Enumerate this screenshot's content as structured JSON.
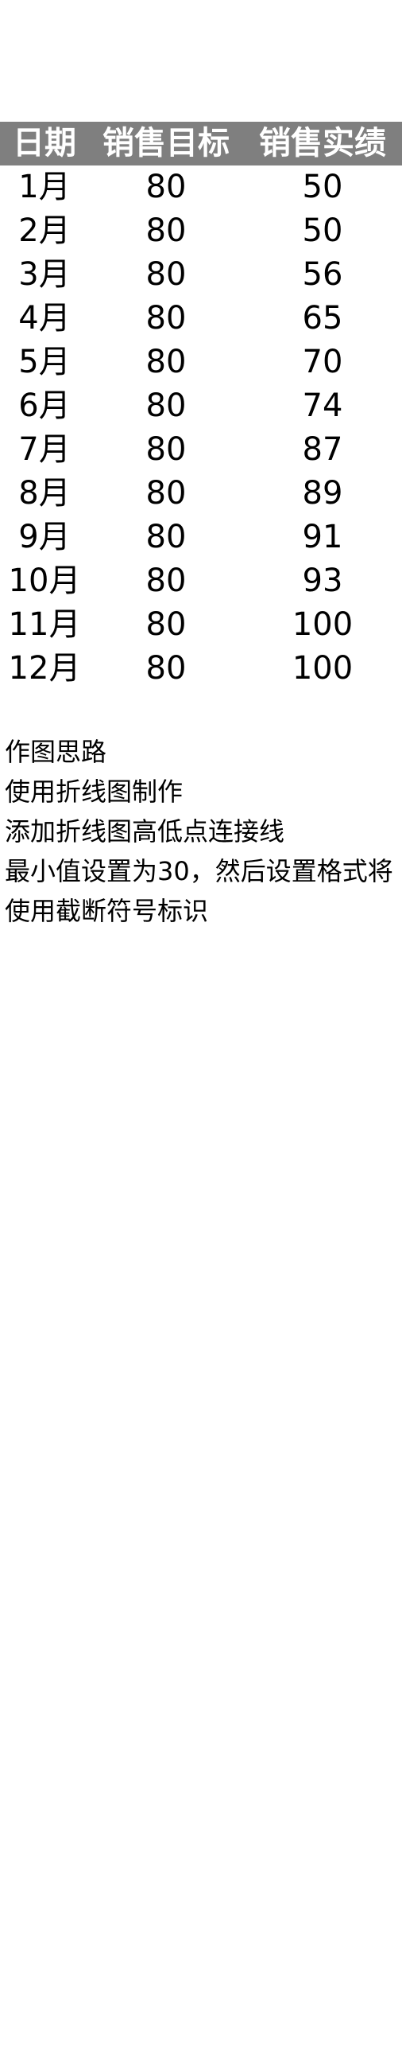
{
  "table": {
    "headers": [
      "日期",
      "销售目标",
      "销售实绩"
    ],
    "rows": [
      {
        "month": "1月",
        "target": "80",
        "actual": "50"
      },
      {
        "month": "2月",
        "target": "80",
        "actual": "50"
      },
      {
        "month": "3月",
        "target": "80",
        "actual": "56"
      },
      {
        "month": "4月",
        "target": "80",
        "actual": "65"
      },
      {
        "month": "5月",
        "target": "80",
        "actual": "70"
      },
      {
        "month": "6月",
        "target": "80",
        "actual": "74"
      },
      {
        "month": "7月",
        "target": "80",
        "actual": "87"
      },
      {
        "month": "8月",
        "target": "80",
        "actual": "89"
      },
      {
        "month": "9月",
        "target": "80",
        "actual": "91"
      },
      {
        "month": "10月",
        "target": "80",
        "actual": "93"
      },
      {
        "month": "11月",
        "target": "80",
        "actual": "100"
      },
      {
        "month": "12月",
        "target": "80",
        "actual": "100"
      }
    ]
  },
  "notes": [
    "作图思路",
    "使用折线图制作",
    "添加折线图高低点连接线",
    "最小值设置为30，然后设置格式将",
    "使用截断符号标识"
  ],
  "colors": {
    "header_bg": "#7f7f7f",
    "header_text": "#ffffff",
    "body_text": "#000000"
  }
}
